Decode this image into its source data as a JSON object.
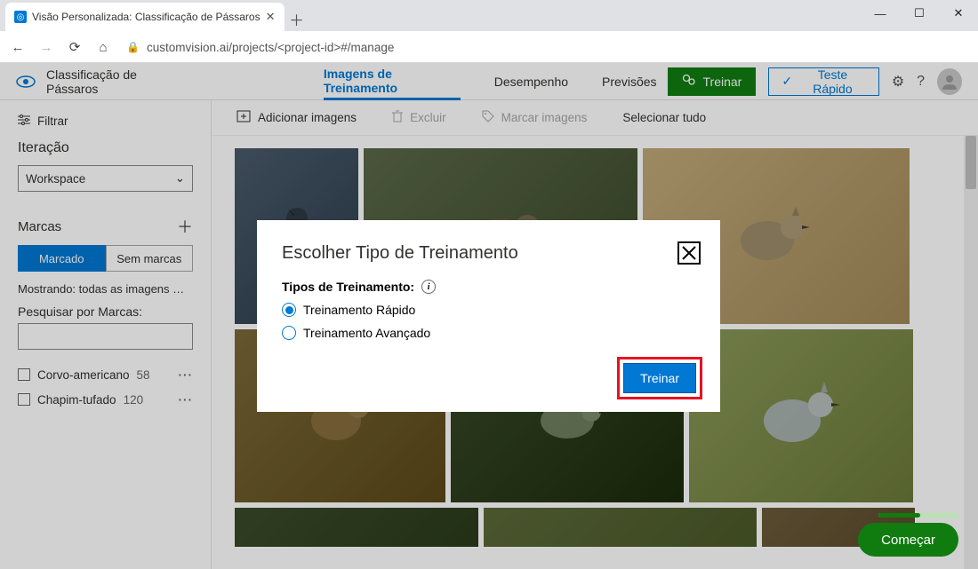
{
  "browser": {
    "tab_title": "Visão Personalizada: Classificação de Pássaros",
    "url": "customvision.ai/projects/<project-id>#/manage"
  },
  "header": {
    "project_name": "Classificação de Pássaros",
    "tabs": {
      "training": "Imagens de Treinamento",
      "performance": "Desempenho",
      "predictions": "Previsões"
    },
    "train_btn": "Treinar",
    "quicktest_btn": "Teste Rápido"
  },
  "sidebar": {
    "filter": "Filtrar",
    "iteration_h": "Iteração",
    "workspace": "Workspace",
    "tags_h": "Marcas",
    "tagged": "Marcado",
    "untagged": "Sem marcas",
    "showing": "Mostrando: todas as imagens ma...",
    "search_lbl": "Pesquisar por Marcas:",
    "tags": [
      {
        "name": "Corvo-americano",
        "count": "58"
      },
      {
        "name": "Chapim-tufado",
        "count": "120"
      }
    ]
  },
  "toolbar": {
    "add": "Adicionar imagens",
    "delete": "Excluir",
    "tag": "Marcar imagens",
    "select_all": "Selecionar tudo"
  },
  "modal": {
    "title": "Escolher Tipo de Treinamento",
    "subheading": "Tipos de Treinamento:",
    "opt_quick": "Treinamento Rápido",
    "opt_advanced": "Treinamento Avançado",
    "train_btn": "Treinar"
  },
  "widget": {
    "start": "Começar"
  }
}
